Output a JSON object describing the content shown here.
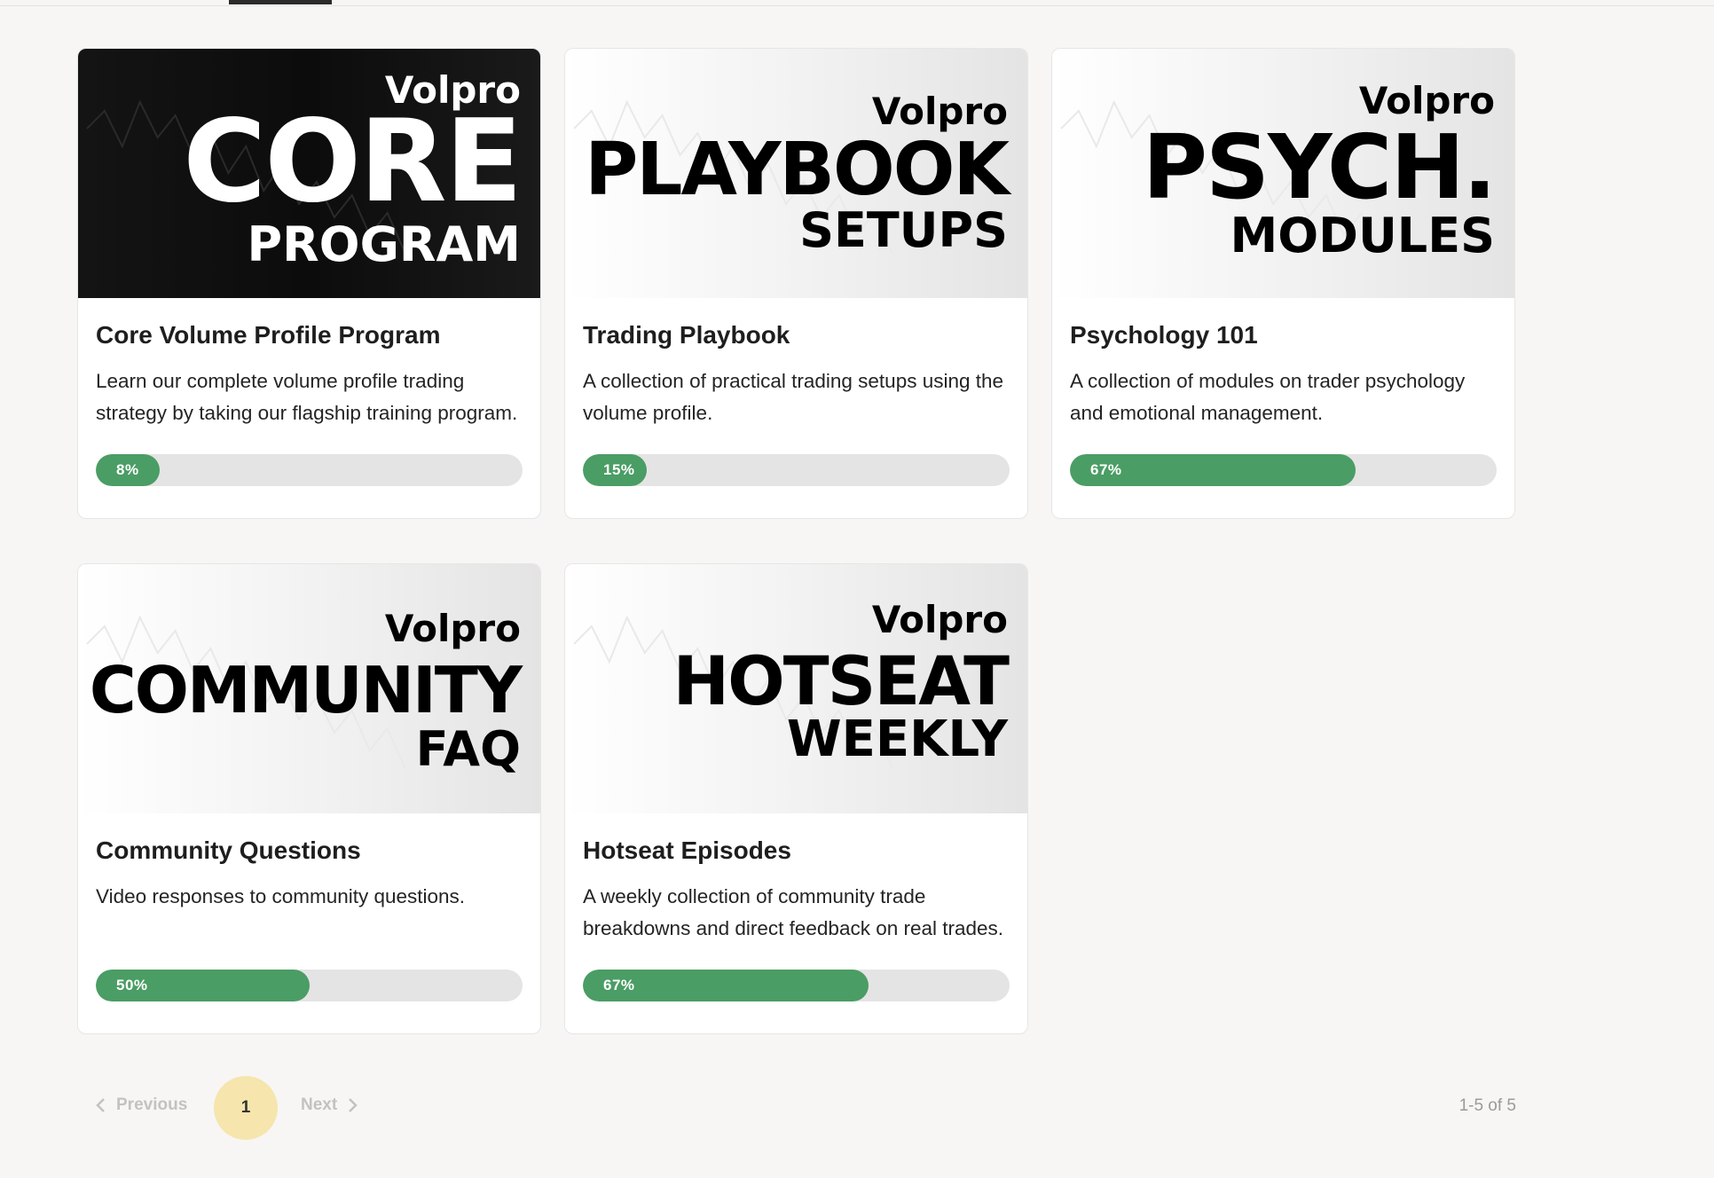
{
  "courses": [
    {
      "logo": {
        "brand": "Volpro",
        "big": "CORE",
        "sub": "PROGRAM"
      },
      "title": "Core Volume Profile Program",
      "description": "Learn our complete volume profile trading strategy by taking our flagship training program.",
      "progress": 8,
      "progress_label": "8%"
    },
    {
      "logo": {
        "brand": "Volpro",
        "big": "PLAYBOOK",
        "sub": "SETUPS"
      },
      "title": "Trading Playbook",
      "description": "A collection of practical trading setups using the volume profile.",
      "progress": 15,
      "progress_label": "15%"
    },
    {
      "logo": {
        "brand": "Volpro",
        "big": "PSYCH.",
        "sub": "MODULES"
      },
      "title": "Psychology 101",
      "description": "A collection of modules on trader psychology and emotional management.",
      "progress": 67,
      "progress_label": "67%"
    },
    {
      "logo": {
        "brand": "Volpro",
        "big": "COMMUNITY",
        "sub": "FAQ"
      },
      "title": "Community Questions",
      "description": "Video responses to community questions.",
      "progress": 50,
      "progress_label": "50%"
    },
    {
      "logo": {
        "brand": "Volpro",
        "big": "HOTSEAT",
        "sub": "WEEKLY"
      },
      "title": "Hotseat Episodes",
      "description": "A weekly collection of community trade breakdowns and direct feedback on real trades.",
      "progress": 67,
      "progress_label": "67%"
    }
  ],
  "pagination": {
    "previous_label": "Previous",
    "current_page": "1",
    "next_label": "Next",
    "count_label": "1-5 of 5"
  },
  "colors": {
    "progress_fill": "#4a9d64",
    "progress_track": "#e4e4e4",
    "active_page": "#f6e5ad"
  }
}
